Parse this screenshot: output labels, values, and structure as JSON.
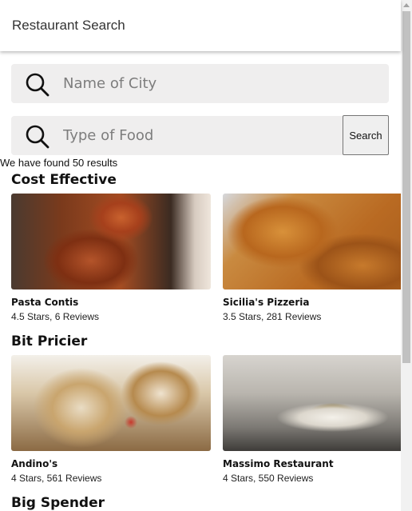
{
  "header": {
    "title": "Restaurant Search"
  },
  "search": {
    "city_placeholder": "Name of City",
    "city_value": "",
    "food_placeholder": "Type of Food",
    "food_value": "",
    "button_label": "Search",
    "icon": "search-icon"
  },
  "results": {
    "count_text": "We have found 50 results"
  },
  "categories": [
    {
      "title": "Cost Effective",
      "restaurants": [
        {
          "name": "Pasta Contis",
          "rating": "4.5 Stars, 6 Reviews"
        },
        {
          "name": "Sicilia's Pizzeria",
          "rating": "3.5 Stars, 281 Reviews"
        }
      ]
    },
    {
      "title": "Bit Pricier",
      "restaurants": [
        {
          "name": "Andino's",
          "rating": "4 Stars, 561 Reviews"
        },
        {
          "name": "Massimo Restaurant",
          "rating": "4 Stars, 550 Reviews"
        }
      ]
    },
    {
      "title": "Big Spender",
      "restaurants": []
    }
  ]
}
